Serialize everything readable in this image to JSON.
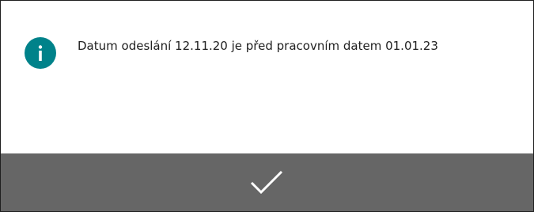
{
  "dialog": {
    "message": "Datum odeslání 12.11.20 je před pracovním datem 01.01.23",
    "icon": "info-icon",
    "ok_icon": "checkmark-icon",
    "colors": {
      "icon_background": "#00828a",
      "action_bar": "#666666",
      "text": "#212121"
    }
  }
}
